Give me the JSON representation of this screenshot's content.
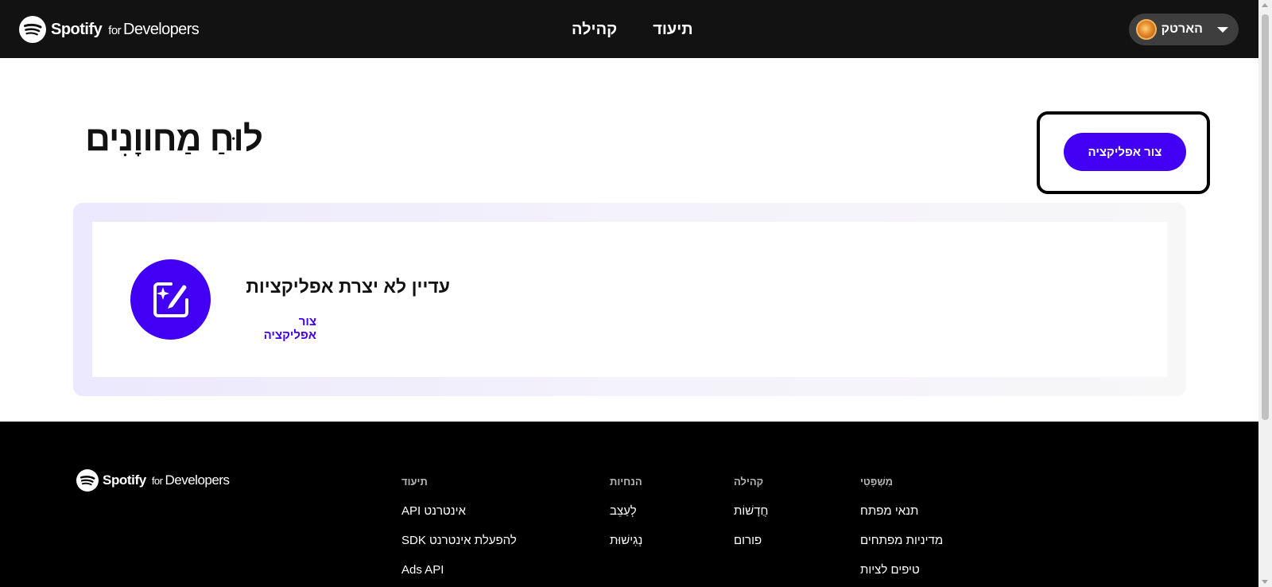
{
  "header": {
    "brand_name": "Spotify",
    "brand_for": "for",
    "brand_developers": "Developers",
    "nav": [
      {
        "label": "קהילה"
      },
      {
        "label": "תיעוד"
      }
    ],
    "user": {
      "name": "הארטק"
    }
  },
  "main": {
    "title": "לוּחַ מַחווָנִים",
    "create_button": "צור אפליקציה",
    "empty_state": {
      "title": "עדיין לא יצרת אפליקציות",
      "link": "צור אפליקציה"
    }
  },
  "footer": {
    "brand_name": "Spotify",
    "brand_for": "for",
    "brand_developers": "Developers",
    "columns": {
      "docs": {
        "heading": "תיעוד",
        "links": [
          "API אינטרנט",
          "SDK להפעלת אינטרנט",
          "Ads API"
        ]
      },
      "guides": {
        "heading": "הנחיות",
        "links": [
          "לְעַצֵב",
          "נְגִישׁוּת"
        ]
      },
      "community": {
        "heading": "קהילה",
        "links": [
          "חֲדָשׁוֹת",
          "פורום"
        ]
      },
      "legal": {
        "heading": "מִשְׁפָּטִי",
        "links": [
          "תנאי מפתח",
          "מדיניות מפתחים",
          "טיפים לציות"
        ]
      }
    }
  },
  "colors": {
    "accent": "#4100f4",
    "header_bg": "#121212",
    "footer_bg": "#000000"
  }
}
